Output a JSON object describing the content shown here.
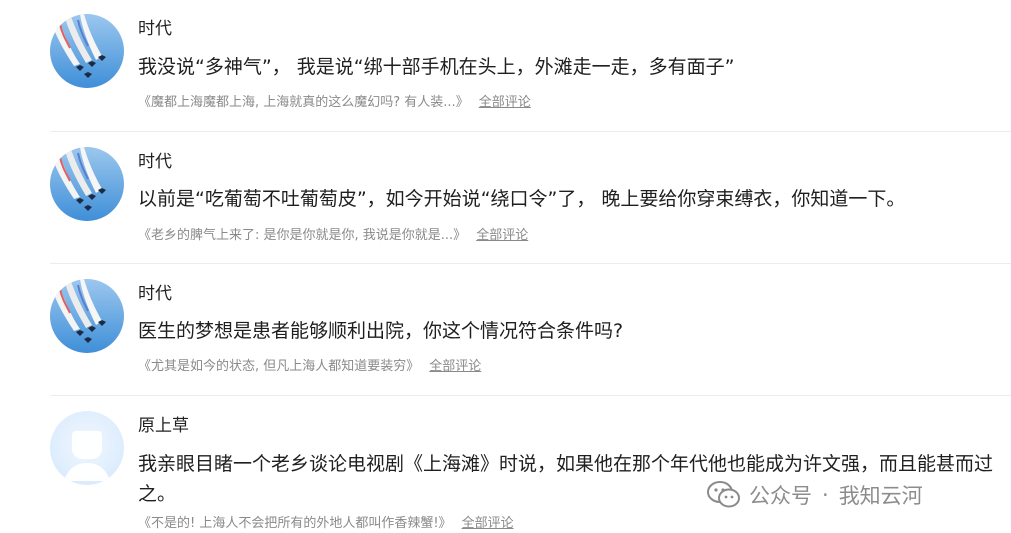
{
  "comments": [
    {
      "author": "时代",
      "text": "我没说“多神气”， 我是说“绑十部手机在头上，外滩走一走，多有面子”",
      "source": "《魔都上海魔都上海, 上海就真的这么魔幻吗? 有人装...》",
      "all_label": "全部评论",
      "avatar": "jets-avatar-icon"
    },
    {
      "author": "时代",
      "text": "以前是“吃葡萄不吐葡萄皮”，如今开始说“绕口令”了， 晚上要给你穿束缚衣，你知道一下。",
      "source": "《老乡的脾气上来了: 是你是你就是你, 我说是你就是...》",
      "all_label": "全部评论",
      "avatar": "jets-avatar-icon"
    },
    {
      "author": "时代",
      "text": "医生的梦想是患者能够顺利出院，你这个情况符合条件吗?",
      "source": "《尤其是如今的状态, 但凡上海人都知道要装穷》",
      "all_label": "全部评论",
      "avatar": "jets-avatar-icon"
    },
    {
      "author": "原上草",
      "text": "我亲眼目睹一个老乡谈论电视剧《上海滩》时说，如果他在那个年代他也能成为许文强，而且能甚而过之。",
      "source": "《不是的! 上海人不会把所有的外地人都叫作香辣蟹!》",
      "all_label": "全部评论",
      "avatar": "default-user-avatar-icon"
    }
  ],
  "watermark": {
    "icon": "wechat-icon",
    "label": "公众号",
    "separator": "·",
    "account": "我知云河"
  },
  "colors": {
    "sky": "#3f8fd8",
    "smoke": "#f2f2f2",
    "text": "#1f1f1f",
    "muted": "#8a8a8a",
    "divider": "#ececec"
  }
}
